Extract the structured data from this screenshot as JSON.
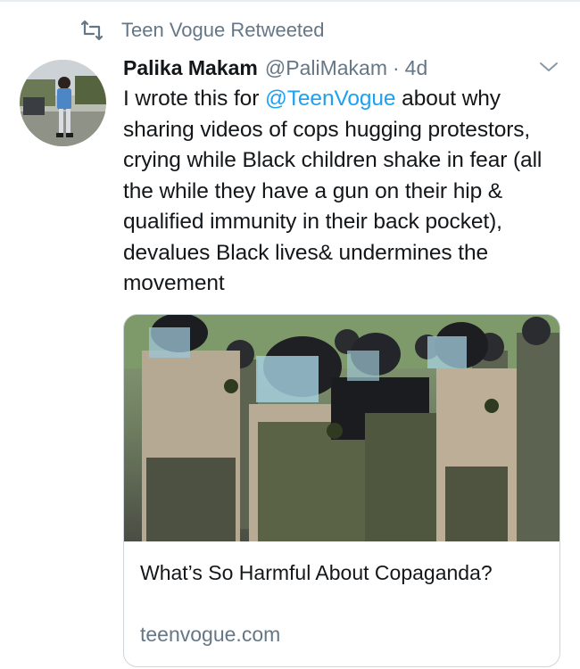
{
  "context": {
    "label": "Teen Vogue Retweeted",
    "icon": "retweet-icon"
  },
  "tweet": {
    "author_name": "Palika Makam",
    "handle": "@PaliMakam",
    "separator": "·",
    "time": "4d",
    "text_before": "I wrote this for ",
    "mention": "@TeenVogue",
    "text_after": " about why sharing videos of cops hugging protestors, crying while Black children shake in fear (all the while they have a gun on their hip & qualified immunity in their back pocket), devalues Black lives& undermines the movement"
  },
  "card": {
    "title": "What’s So Harmful About Copaganda?",
    "domain": "teenvogue.com"
  },
  "colors": {
    "link": "#1da1f2",
    "secondary": "#657786",
    "text": "#14171a",
    "border": "#ccd6dd"
  }
}
